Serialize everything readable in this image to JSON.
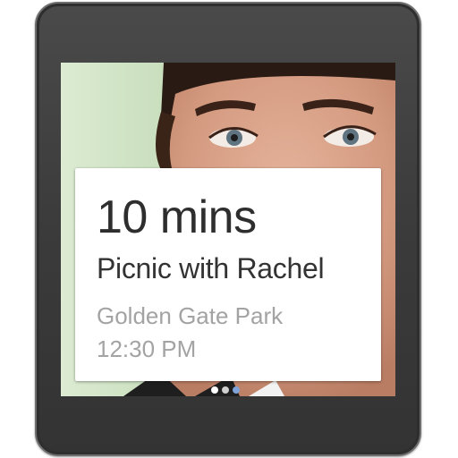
{
  "notification": {
    "time_remaining": "10 mins",
    "title": "Picnic with Rachel",
    "location": "Golden Gate Park",
    "time": "12:30 PM"
  },
  "pager": {
    "count": 3,
    "active_index": 0
  },
  "colors": {
    "watch_bezel": "#3b3b3b",
    "card_background": "#ffffff",
    "primary_text": "#2e2e2e",
    "secondary_text": "#a3a3a3",
    "pager_accent": "#7fa3d9"
  }
}
